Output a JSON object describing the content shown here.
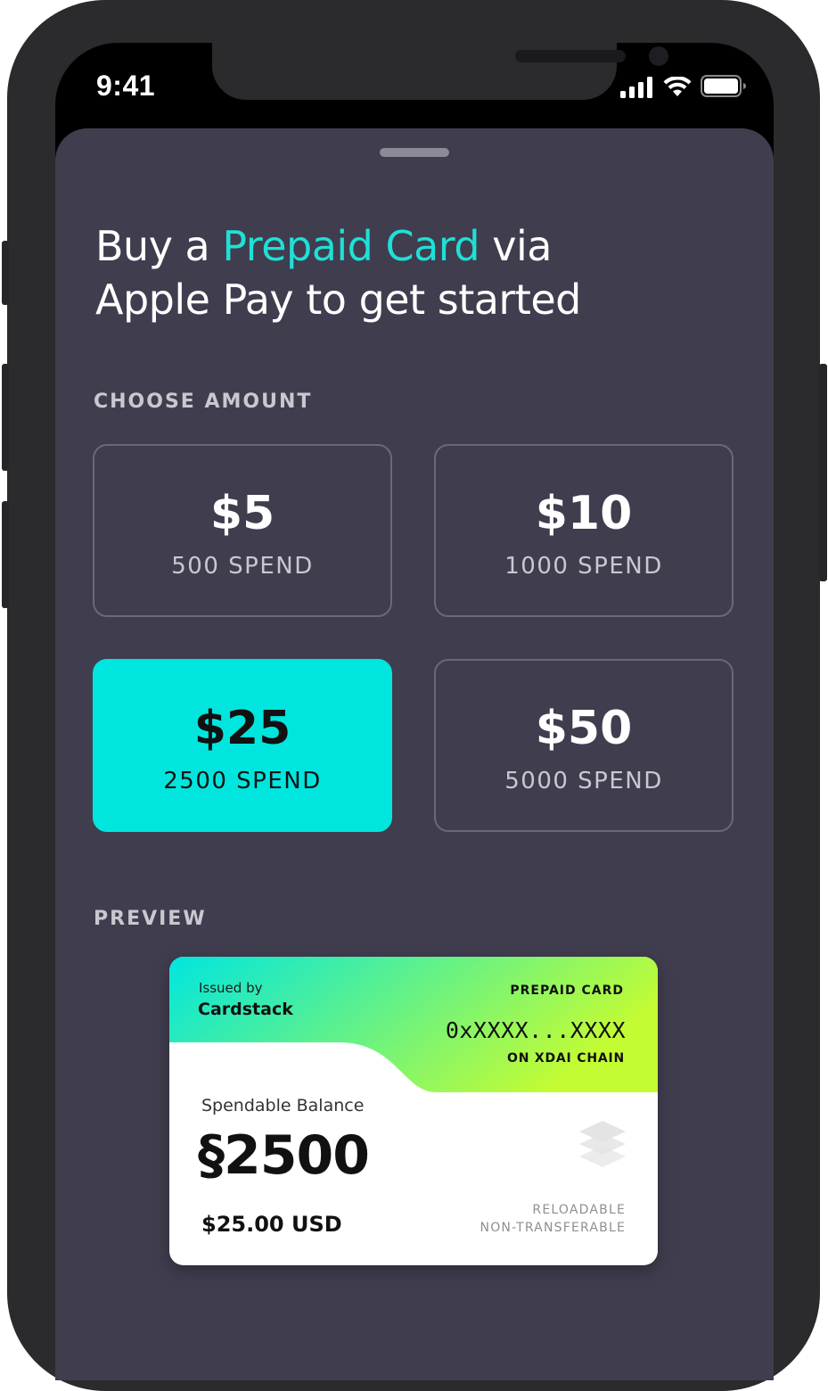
{
  "status_bar": {
    "time": "9:41",
    "icons": [
      "cellular-signal-icon",
      "wifi-icon",
      "battery-icon"
    ]
  },
  "headline": {
    "part1": "Buy a ",
    "accent": "Prepaid Card",
    "part2": " via",
    "line2": "Apple Pay to get started"
  },
  "choose_amount": {
    "label": "CHOOSE AMOUNT",
    "options": [
      {
        "price": "$5",
        "spend": "500 SPEND",
        "selected": false
      },
      {
        "price": "$10",
        "spend": "1000 SPEND",
        "selected": false
      },
      {
        "price": "$25",
        "spend": "2500 SPEND",
        "selected": true
      },
      {
        "price": "$50",
        "spend": "5000 SPEND",
        "selected": false
      }
    ]
  },
  "preview": {
    "label": "PREVIEW",
    "card": {
      "issued_by": "Issued by",
      "issuer": "Cardstack",
      "type_label": "PREPAID CARD",
      "address": "0xXXXX...XXXX",
      "chain": "ON XDAI CHAIN",
      "balance_label": "Spendable Balance",
      "balance": "§2500",
      "usd": "$25.00 USD",
      "reloadable": "RELOADABLE",
      "non_transferable": "NON-TRANSFERABLE"
    }
  },
  "colors": {
    "accent": "#1ee0d6",
    "selected_tile": "#00e6df",
    "sheet_bg": "#403d4f",
    "gradient_start": "#00e6df",
    "gradient_end": "#c3fc33"
  }
}
